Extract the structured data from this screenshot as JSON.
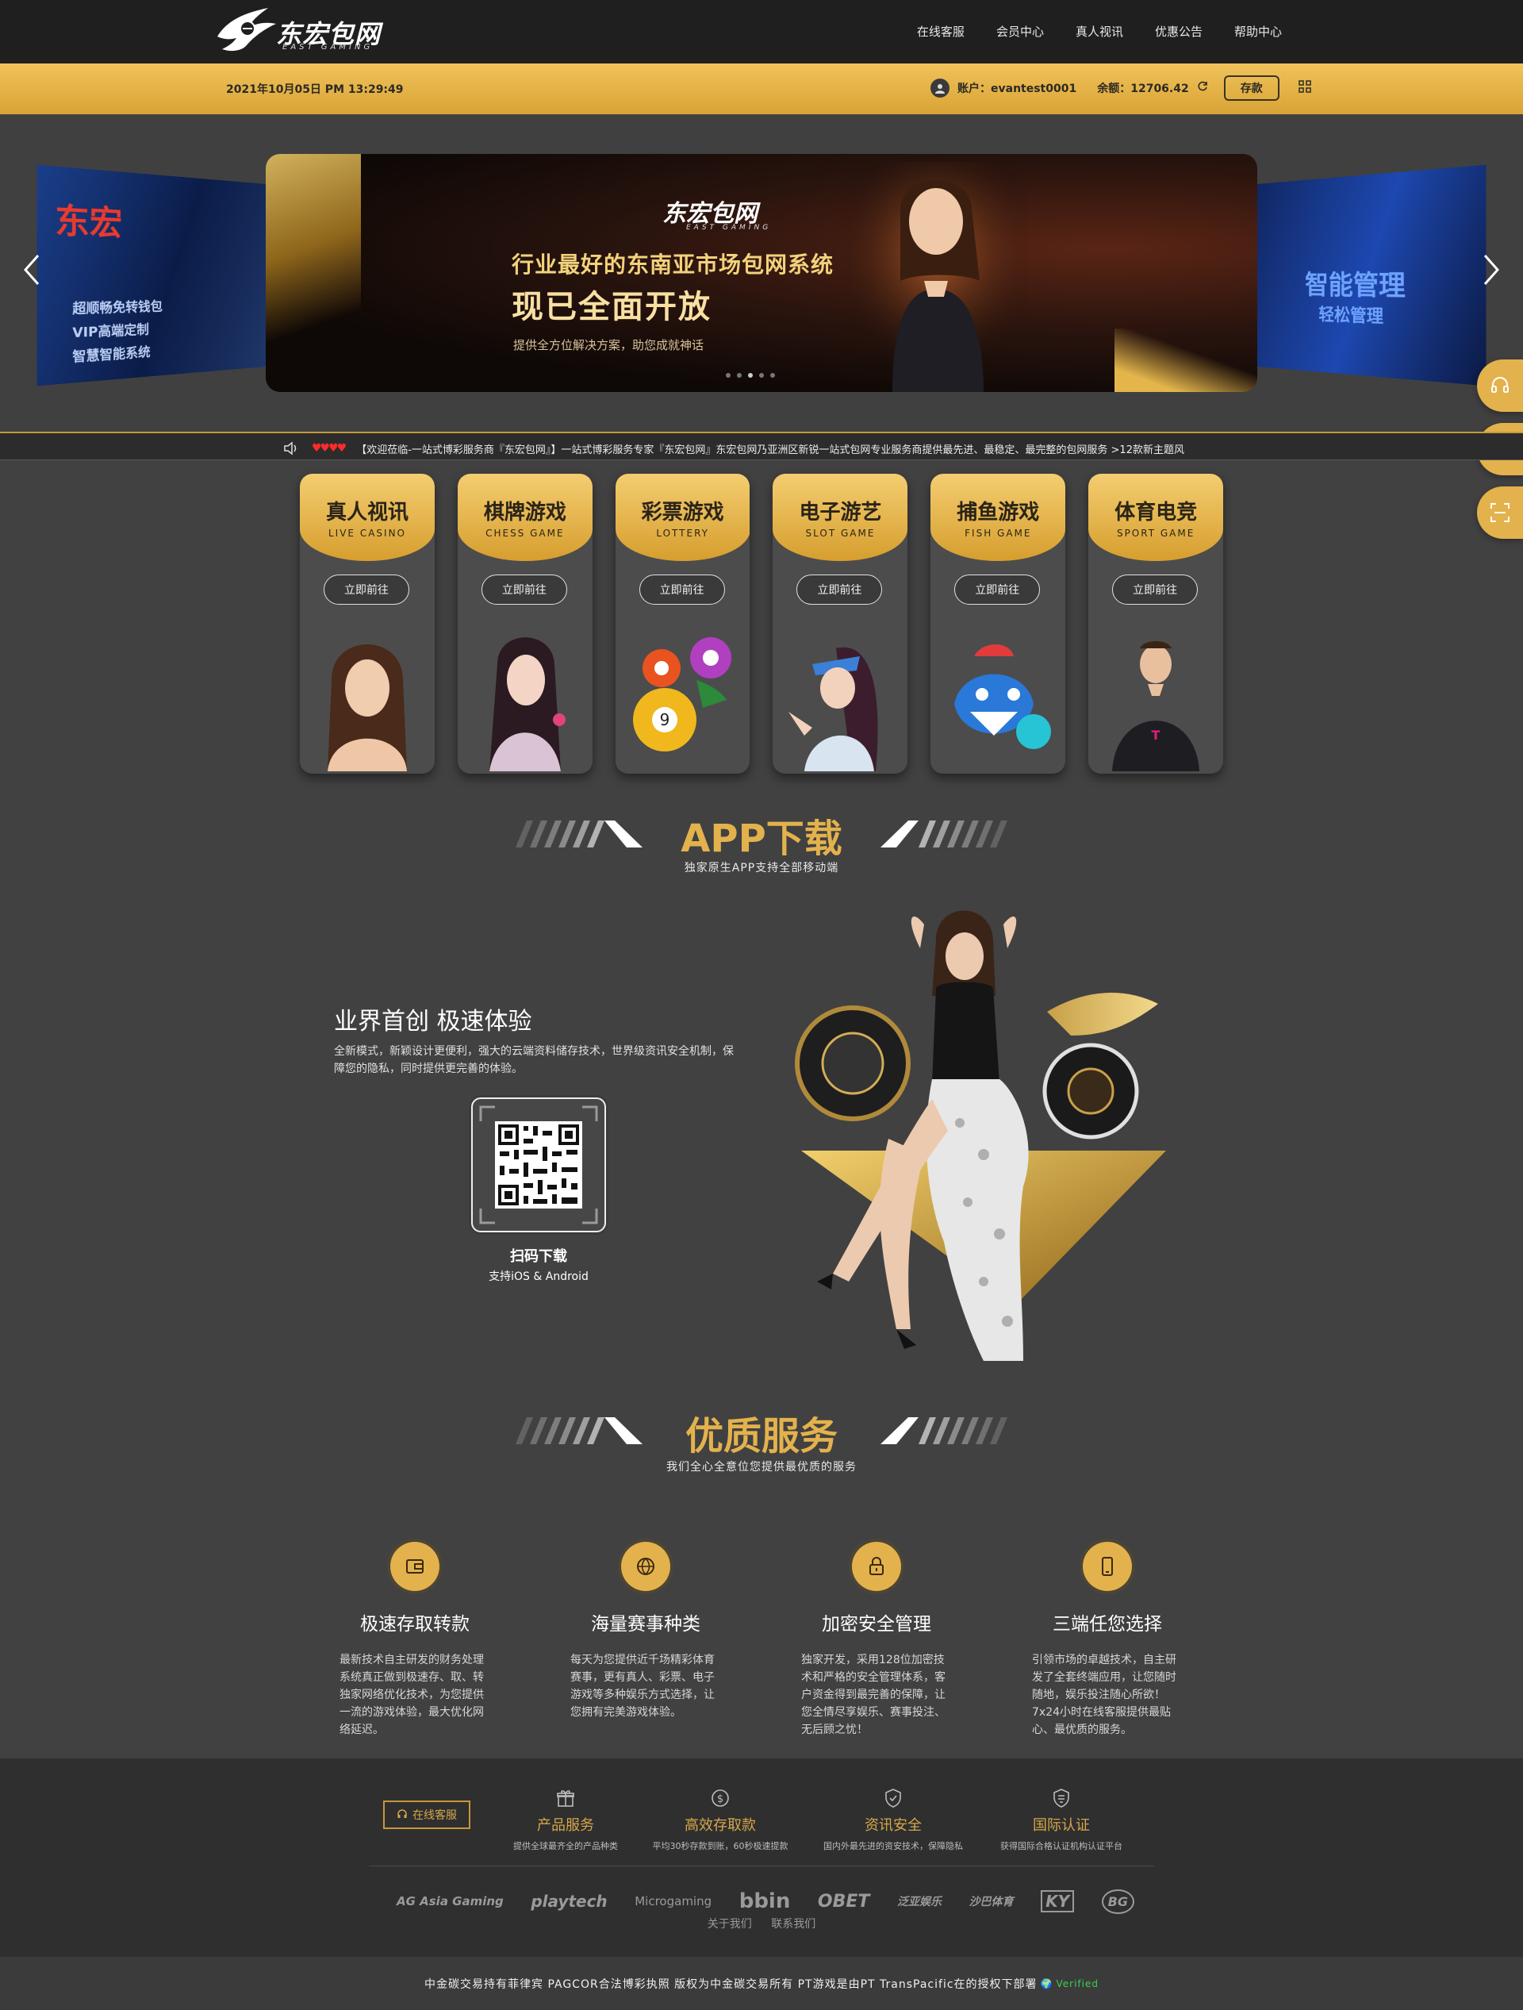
{
  "header": {
    "logo_cn": "东宏包网",
    "logo_en": "EAST GAMING",
    "nav": [
      "在线客服",
      "会员中心",
      "真人视讯",
      "优惠公告",
      "帮助中心"
    ]
  },
  "userbar": {
    "datetime": "2021年10月05日 PM 13:29:49",
    "account": "账户：evantest0001",
    "balance": "余额：12706.42",
    "deposit": "存款"
  },
  "banner": {
    "logo_cn": "东宏包网",
    "logo_en": "EAST GAMING",
    "line1": "行业最好的东南亚市场包网系统",
    "line2": "现已全面开放",
    "line3": "提供全方位解决方案，助您成就神话",
    "left_side": [
      "超顺畅免转钱包",
      "VIP高端定制",
      "智慧智能系统"
    ],
    "right_side": [
      "智能管理",
      "轻松管理"
    ]
  },
  "marquee": {
    "text": "【欢迎莅临-一站式博彩服务商『东宏包网』】一站式博彩服务专家『东宏包网』东宏包网乃亚洲区新锐一站式包网专业服务商提供最先进、最稳定、最完整的包网服务 >12款新主题风"
  },
  "games": [
    {
      "cn": "真人视讯",
      "en": "LIVE CASINO",
      "btn": "立即前往"
    },
    {
      "cn": "棋牌游戏",
      "en": "CHESS GAME",
      "btn": "立即前往"
    },
    {
      "cn": "彩票游戏",
      "en": "LOTTERY",
      "btn": "立即前往"
    },
    {
      "cn": "电子游艺",
      "en": "SLOT GAME",
      "btn": "立即前往"
    },
    {
      "cn": "捕鱼游戏",
      "en": "FISH GAME",
      "btn": "立即前往"
    },
    {
      "cn": "体育电竞",
      "en": "SPORT GAME",
      "btn": "立即前往"
    }
  ],
  "app": {
    "title": "APP下载",
    "subtitle": "独家原生APP支持全部移动端",
    "heading": "业界首创 极速体验",
    "desc": "全新模式，新颖设计更便利，强大的云端资料储存技术，世界级资讯安全机制，保障您的隐私，同时提供更完善的体验。",
    "scan": "扫码下载",
    "platforms": "支持iOS & Android"
  },
  "service": {
    "title": "优质服务",
    "subtitle": "我们全心全意位您提供最优质的服务",
    "items": [
      {
        "title": "极速存取转款",
        "desc": "最新技术自主研发的财务处理系统真正做到极速存、取、转独家网络优化技术，为您提供一流的游戏体验，最大优化网络延迟。"
      },
      {
        "title": "海量赛事种类",
        "desc": "每天为您提供近千场精彩体育赛事，更有真人、彩票、电子游戏等多种娱乐方式选择，让您拥有完美游戏体验。"
      },
      {
        "title": "加密安全管理",
        "desc": "独家开发，采用128位加密技术和严格的安全管理体系，客户资金得到最完善的保障，让您全情尽享娱乐、赛事投注、无后顾之忧！"
      },
      {
        "title": "三端任您选择",
        "desc": "引领市场的卓越技术，自主研发了全套终端应用，让您随时随地，娱乐投注随心所欲！7x24小时在线客服提供最贴心、最优质的服务。"
      }
    ]
  },
  "footer": {
    "cs_button": "在线客服",
    "features": [
      {
        "title": "产品服务",
        "desc": "提供全球最齐全的产品种类"
      },
      {
        "title": "高效存取款",
        "desc": "平均30秒存款到账，60秒极速提款"
      },
      {
        "title": "资讯安全",
        "desc": "国内外最先进的资安技术，保障隐私"
      },
      {
        "title": "国际认证",
        "desc": "获得国际合格认证机构认证平台"
      }
    ],
    "providers": [
      "AG Asia Gaming",
      "playtech",
      "Microgaming",
      "bbin",
      "OBET",
      "泛亚娱乐",
      "沙巴体育",
      "KY",
      "BG"
    ],
    "links": [
      "关于我们",
      "联系我们"
    ],
    "copyright": "中金碳交易持有菲律宾 PAGCOR合法博彩执照 版权为中金碳交易所有 PT游戏是由PT TransPacific在的授权下部署",
    "badge": "Verified"
  },
  "colors": {
    "gold": "#e3b24c",
    "bg": "#414141",
    "header": "#1f1f20"
  }
}
